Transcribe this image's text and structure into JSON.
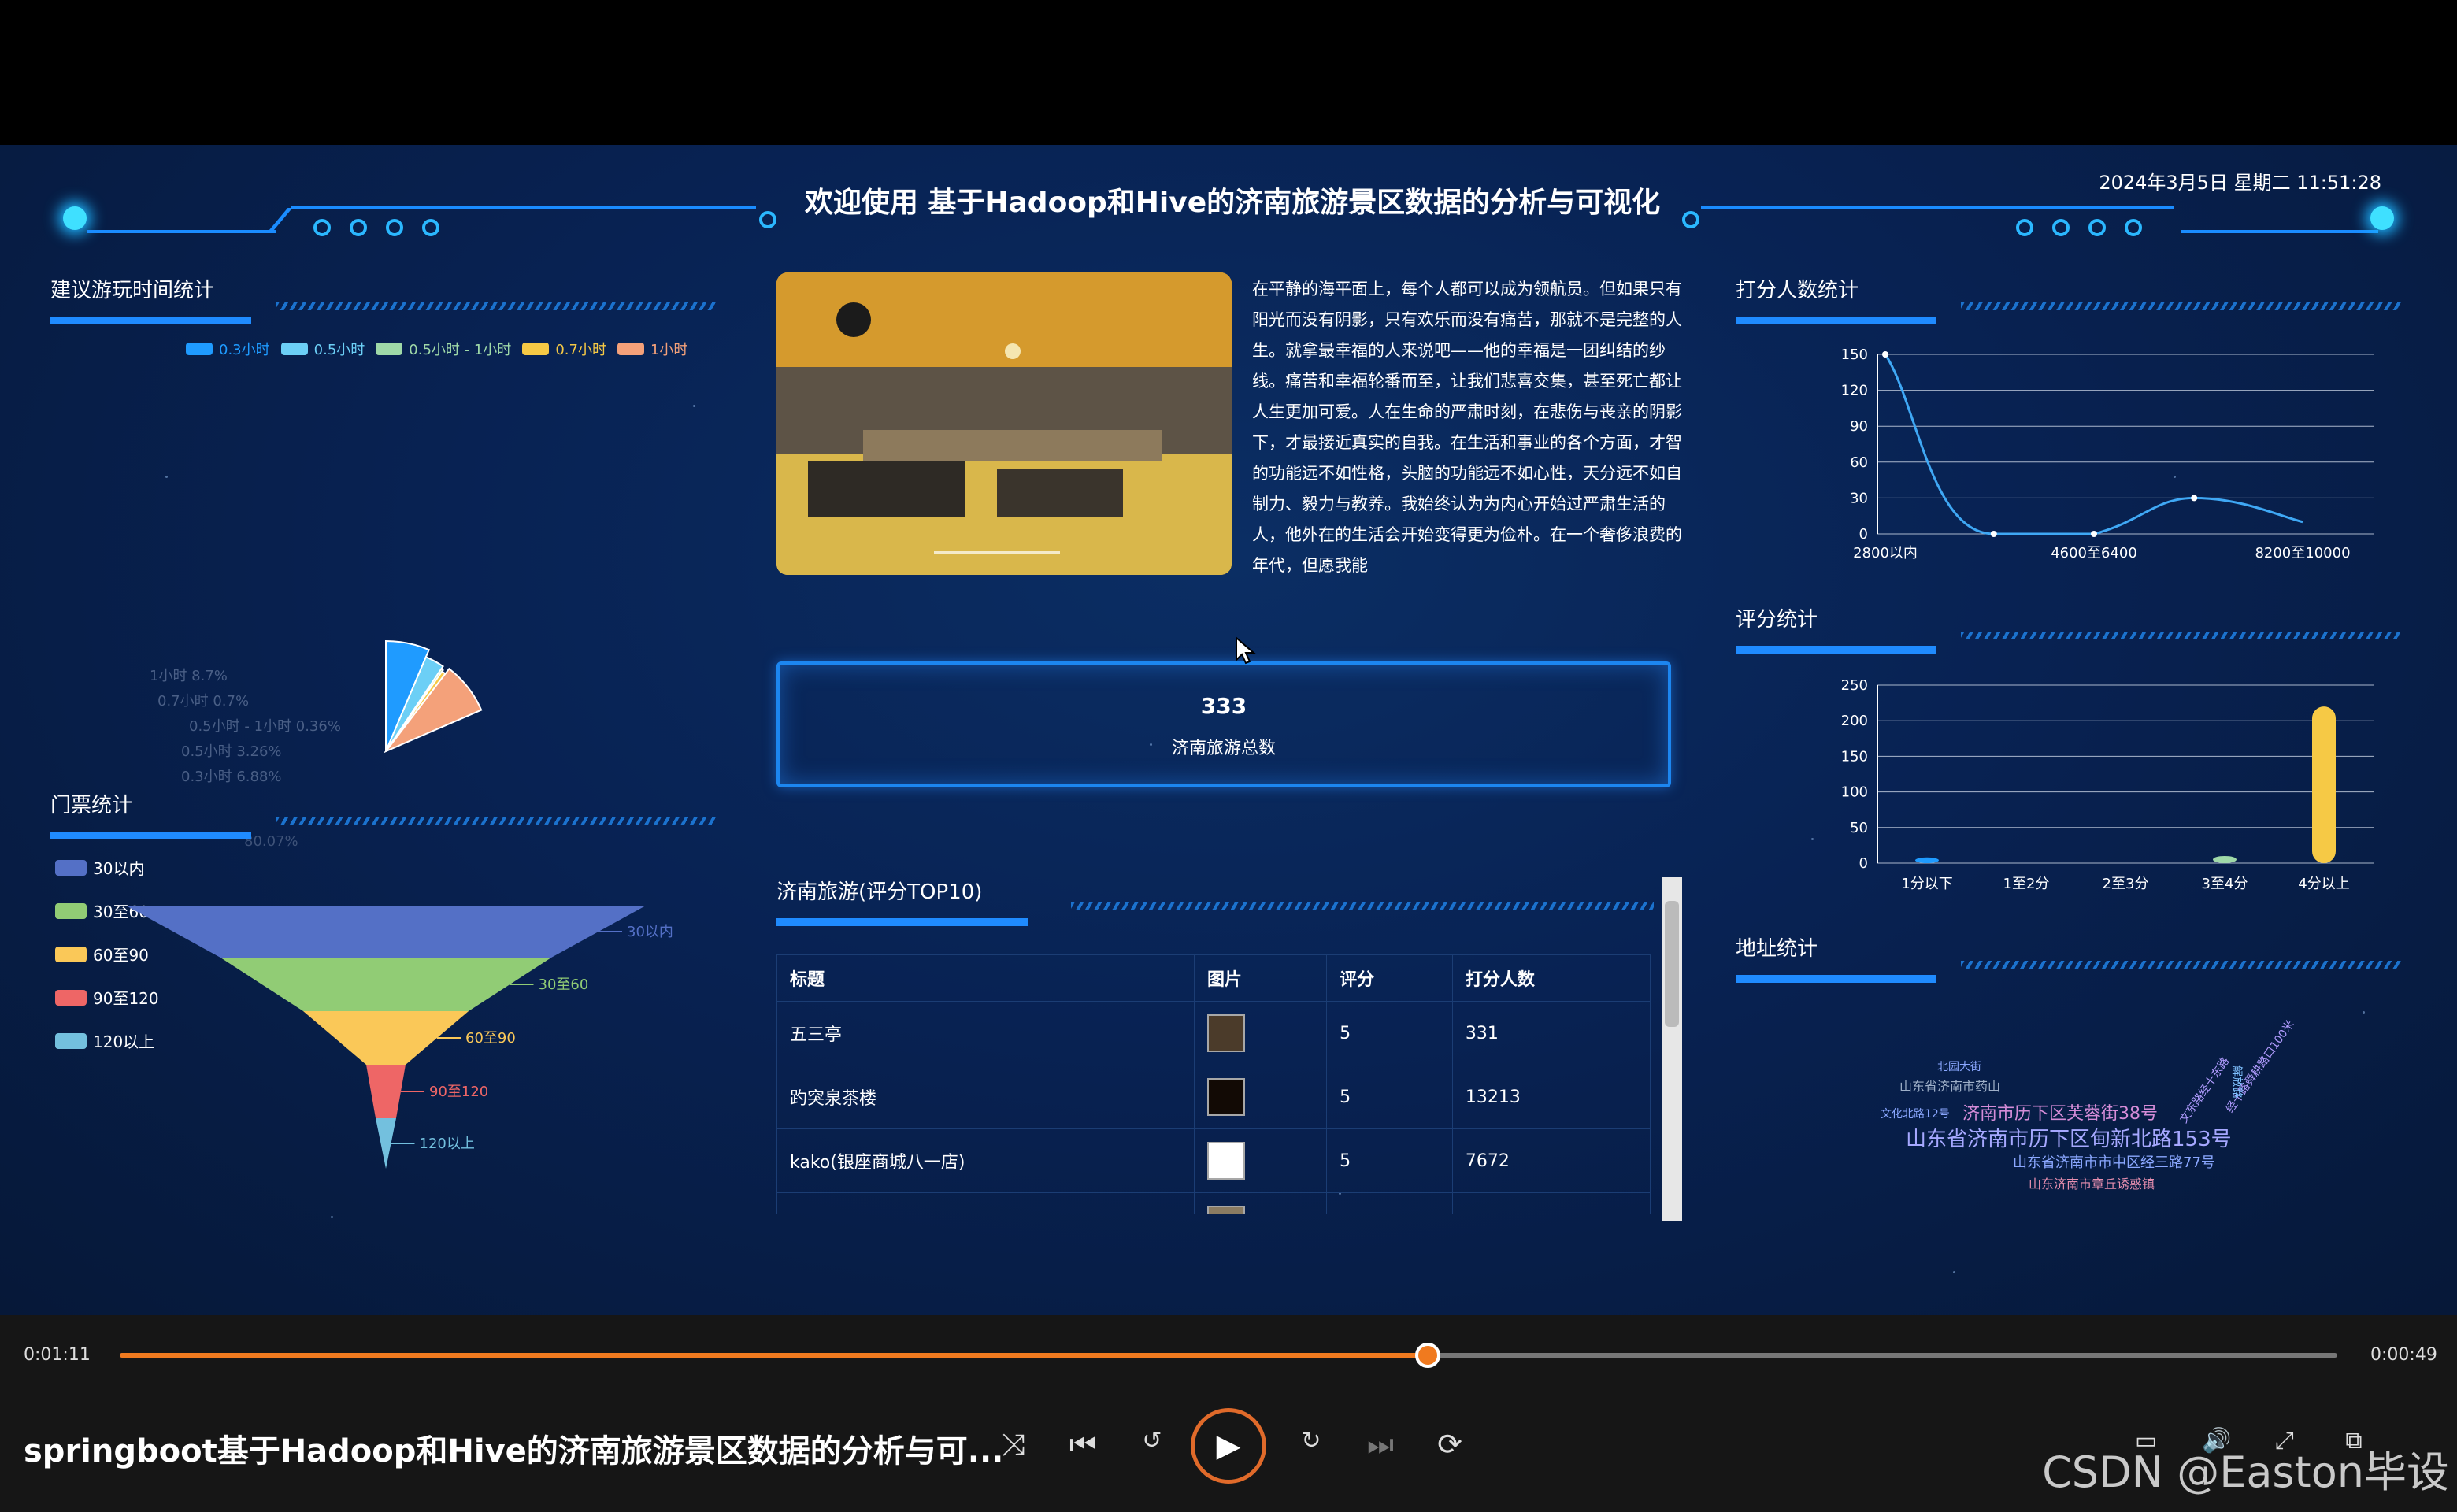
{
  "header": {
    "title": "欢迎使用 基于Hadoop和Hive的济南旅游景区数据的分析与可视化",
    "datetime": "2024年3月5日 星期二 11:51:28"
  },
  "panels": {
    "play_time": {
      "title": "建议游玩时间统计",
      "legend": [
        {
          "label": "0.3小时",
          "color": "#1f9bff"
        },
        {
          "label": "0.5小时",
          "color": "#6ccff6"
        },
        {
          "label": "0.5小时 - 1小时",
          "color": "#9fd9a8"
        },
        {
          "label": "0.7小时",
          "color": "#f6c945"
        },
        {
          "label": "1小时",
          "color": "#f4a17a"
        }
      ],
      "labels": [
        "1小时 8.7%",
        "0.7小时 0.7%",
        "0.5小时 - 1小时 0.36%",
        "0.5小时 3.26%",
        "0.3小时 6.88%",
        "80.07%"
      ]
    },
    "ticket": {
      "title": "门票统计",
      "legend": [
        {
          "label": "30以内",
          "color": "#5470c6"
        },
        {
          "label": "30至60",
          "color": "#91cc75"
        },
        {
          "label": "60至90",
          "color": "#fac858"
        },
        {
          "label": "90至120",
          "color": "#ee6666"
        },
        {
          "label": "120以上",
          "color": "#73c0de"
        }
      ]
    },
    "raters": {
      "title": "打分人数统计"
    },
    "score": {
      "title": "评分统计"
    },
    "address": {
      "title": "地址统计",
      "words": [
        {
          "text": "北园大街",
          "color": "#8aa7ff"
        },
        {
          "text": "山东省济南市药山",
          "color": "#9fb0c8"
        },
        {
          "text": "文化北路12号",
          "color": "#8aa7ff"
        },
        {
          "text": "济南市历下区芙蓉街38号",
          "color": "#d58cd8"
        },
        {
          "text": "山东省济南市历下区甸新北路153号",
          "color": "#a6a8ff"
        },
        {
          "text": "山东省济南市市中区经三路77号",
          "color": "#8aa7ff"
        },
        {
          "text": "山东济南市章丘诱惑镇",
          "color": "#e88fb0"
        },
        {
          "text": "文东路经十东路",
          "color": "#b19cff"
        },
        {
          "text": "经十路舜耕路口100米",
          "color": "#b19cff"
        },
        {
          "text": "解放路",
          "color": "#7fc1ff"
        }
      ]
    }
  },
  "center": {
    "intro": "在平静的海平面上，每个人都可以成为领航员。但如果只有阳光而没有阴影，只有欢乐而没有痛苦，那就不是完整的人生。就拿最幸福的人来说吧——他的幸福是一团纠结的纱线。痛苦和幸福轮番而至，让我们悲喜交集，甚至死亡都让人生更加可爱。人在生命的严肃时刻，在悲伤与丧亲的阴影下，才最接近真实的自我。在生活和事业的各个方面，才智的功能远不如性格，头脑的功能远不如心性，天分远不如自制力、毅力与教养。我始终认为为内心开始过严肃生活的人，他外在的生活会开始变得更为俭朴。在一个奢侈浪费的年代，但愿我能",
    "total_value": "333",
    "total_label": "济南旅游总数",
    "top10_title": "济南旅游(评分TOP10)",
    "table": {
      "headers": [
        "标题",
        "图片",
        "评分",
        "打分人数"
      ],
      "rows": [
        {
          "title": "五三亭",
          "score": "5",
          "count": "331"
        },
        {
          "title": "趵突泉茶楼",
          "score": "5",
          "count": "13213"
        },
        {
          "title": "kako(银座商城八一店)",
          "score": "5",
          "count": "7672"
        },
        {
          "title": "",
          "score": "",
          "count": ""
        }
      ]
    }
  },
  "chart_data": [
    {
      "type": "pie",
      "title": "建议游玩时间统计",
      "categories": [
        "0.3小时",
        "0.5小时",
        "0.5小时 - 1小时",
        "0.7小时",
        "1小时"
      ],
      "values": [
        6.88,
        3.26,
        0.36,
        0.7,
        8.7
      ],
      "note_label": "80.07%"
    },
    {
      "type": "funnel",
      "title": "门票统计",
      "categories": [
        "30以内",
        "30至60",
        "60至90",
        "90至120",
        "120以上"
      ],
      "values": [
        100,
        80,
        55,
        30,
        15
      ]
    },
    {
      "type": "line",
      "title": "打分人数统计",
      "x": [
        "2800以内",
        "4600至6400",
        "8200至10000"
      ],
      "points": [
        {
          "x": "2800以内",
          "y": 150
        },
        {
          "x": "2800以内+",
          "y": 0
        },
        {
          "x": "4600至6400",
          "y": 0
        },
        {
          "x": "4600至6400+",
          "y": 30
        },
        {
          "x": "8200至10000",
          "y": 10
        }
      ],
      "y_ticks": [
        0,
        30,
        60,
        90,
        120,
        150
      ],
      "ylim": [
        0,
        150
      ]
    },
    {
      "type": "bar",
      "title": "评分统计",
      "categories": [
        "1分以下",
        "1至2分",
        "2至3分",
        "3至4分",
        "4分以上"
      ],
      "values": [
        8,
        0,
        0,
        10,
        220
      ],
      "colors": [
        "#1f9bff",
        "#6ccff6",
        "#6ccff6",
        "#9fd9a8",
        "#f6c945"
      ],
      "y_ticks": [
        0,
        50,
        100,
        150,
        200,
        250
      ],
      "ylim": [
        0,
        250
      ]
    }
  ],
  "player": {
    "elapsed": "0:01:11",
    "remaining": "0:00:49",
    "progress": 0.59,
    "video_title": "springboot基于Hadoop和Hive的济南旅游景区数据的分析与可...",
    "watermark": "CSDN @Easton毕设"
  }
}
